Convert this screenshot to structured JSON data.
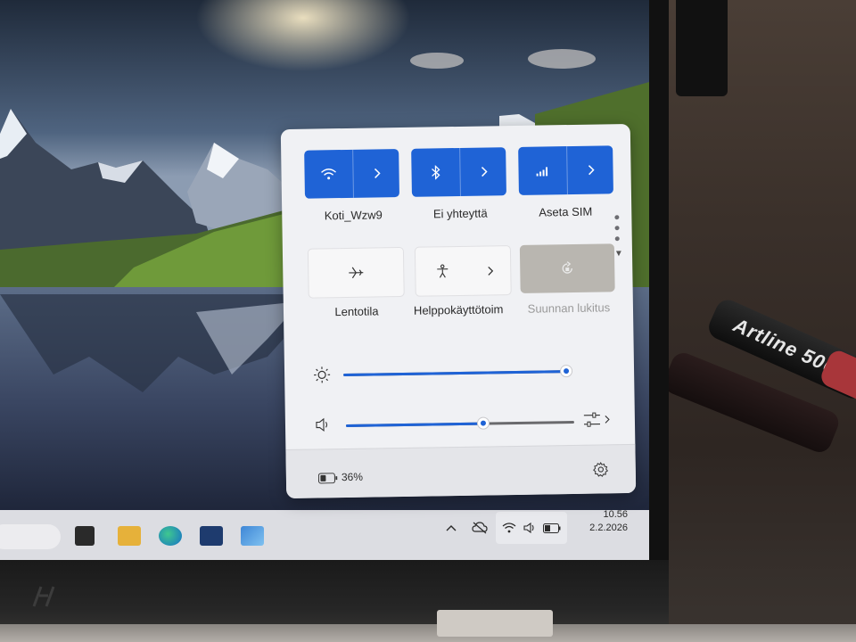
{
  "quick_settings": {
    "wifi": {
      "label": "Koti_Wzw9",
      "icon": "wifi-icon",
      "state": "on"
    },
    "bluetooth": {
      "label": "Ei yhteyttä",
      "icon": "bluetooth-icon",
      "state": "on"
    },
    "cellular": {
      "label": "Aseta SIM",
      "icon": "cellular-signal-icon",
      "state": "on"
    },
    "airplane": {
      "label": "Lentotila",
      "icon": "airplane-icon",
      "state": "off"
    },
    "accessibility": {
      "label": "Helppokäyttötoim",
      "icon": "accessibility-icon",
      "state": "off"
    },
    "rotation_lock": {
      "label": "Suunnan lukitus",
      "icon": "rotation-lock-icon",
      "state": "disabled"
    },
    "brightness": {
      "icon": "brightness-icon",
      "level": 1.0
    },
    "volume": {
      "icon": "speaker-icon",
      "level": 0.6
    },
    "battery": {
      "icon": "battery-icon",
      "text": "36%"
    },
    "settings": {
      "icon": "gear-icon"
    }
  },
  "taskbar": {
    "apps": [
      "file-explorer-icon",
      "edge-browser-icon",
      "store-icon",
      "remote-desktop-icon"
    ],
    "tray": [
      "chevron-up-icon",
      "cloud-offline-icon",
      "wifi-icon",
      "speaker-icon",
      "battery-icon"
    ],
    "time": "10.56",
    "date": "2.2.2026"
  },
  "colors": {
    "accent": "#1f63d6",
    "panel": "#f0f1f4",
    "taskbar": "#dcdde2"
  },
  "photo": {
    "marker_text": "Artline 500"
  }
}
